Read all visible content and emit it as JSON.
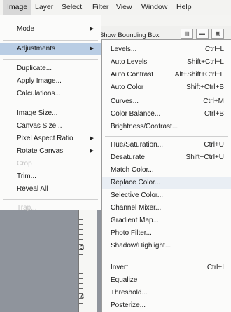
{
  "menubar": [
    "Image",
    "Layer",
    "Select",
    "Filter",
    "View",
    "Window",
    "Help"
  ],
  "options_bar": {
    "bounding_box_label": "Show Bounding Box"
  },
  "ruler": {
    "numbers": [
      "3",
      "4"
    ]
  },
  "image_menu": [
    {
      "label": "Mode",
      "submenu": true
    },
    {
      "label": "Adjustments",
      "submenu": true,
      "state": "highlighted"
    },
    {
      "label": "Duplicate..."
    },
    {
      "label": "Apply Image..."
    },
    {
      "label": "Calculations..."
    },
    {
      "label": "Image Size..."
    },
    {
      "label": "Canvas Size..."
    },
    {
      "label": "Pixel Aspect Ratio",
      "submenu": true
    },
    {
      "label": "Rotate Canvas",
      "submenu": true
    },
    {
      "label": "Crop",
      "disabled": true
    },
    {
      "label": "Trim..."
    },
    {
      "label": "Reveal All"
    },
    {
      "label": "Trap...",
      "disabled": true
    }
  ],
  "adjustments_menu": [
    {
      "label": "Levels...",
      "shortcut": "Ctrl+L"
    },
    {
      "label": "Auto Levels",
      "shortcut": "Shift+Ctrl+L"
    },
    {
      "label": "Auto Contrast",
      "shortcut": "Alt+Shift+Ctrl+L"
    },
    {
      "label": "Auto Color",
      "shortcut": "Shift+Ctrl+B"
    },
    {
      "label": "Curves...",
      "shortcut": "Ctrl+M"
    },
    {
      "label": "Color Balance...",
      "shortcut": "Ctrl+B"
    },
    {
      "label": "Brightness/Contrast..."
    },
    {
      "label": "Hue/Saturation...",
      "shortcut": "Ctrl+U"
    },
    {
      "label": "Desaturate",
      "shortcut": "Shift+Ctrl+U"
    },
    {
      "label": "Match Color..."
    },
    {
      "label": "Replace Color...",
      "state": "hover"
    },
    {
      "label": "Selective Color..."
    },
    {
      "label": "Channel Mixer..."
    },
    {
      "label": "Gradient Map..."
    },
    {
      "label": "Photo Filter..."
    },
    {
      "label": "Shadow/Highlight..."
    },
    {
      "label": "Invert",
      "shortcut": "Ctrl+I"
    },
    {
      "label": "Equalize"
    },
    {
      "label": "Threshold..."
    },
    {
      "label": "Posterize..."
    }
  ]
}
